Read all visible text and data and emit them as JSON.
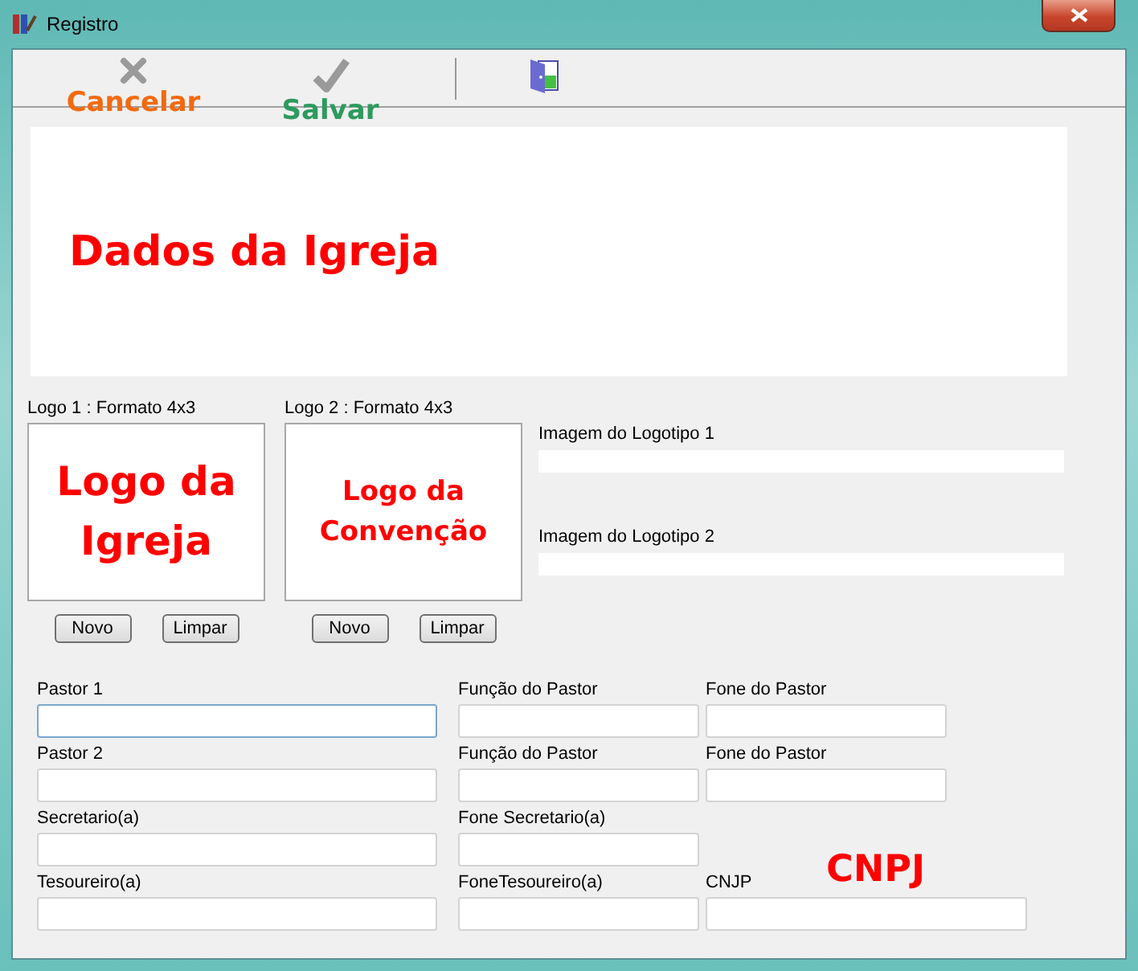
{
  "window": {
    "title": "Registro"
  },
  "toolbar": [
    {
      "kind": "cancel",
      "label": "Cancelar",
      "color": "#f26a10"
    },
    {
      "kind": "save",
      "label": "Salvar",
      "color": "#2e9a5e"
    },
    {
      "kind": "exit"
    }
  ],
  "header": {
    "title": "Dados da Igreja"
  },
  "logos": [
    {
      "label": "Logo 1 : Formato 4x3",
      "text": "Logo da Igreja",
      "buttons": [
        "Novo",
        "Limpar"
      ]
    },
    {
      "label": "Logo 2 : Formato 4x3",
      "text": "Logo da Convenção",
      "buttons": [
        "Novo",
        "Limpar"
      ]
    }
  ],
  "logo_paths": [
    {
      "label": "Imagem do Logotipo 1"
    },
    {
      "label": "Imagem do Logotipo 2"
    }
  ],
  "form_rows": [
    [
      {
        "label": "Pastor 1",
        "focused": true
      },
      {
        "label": "Função do Pastor",
        "focused": false
      },
      {
        "label": "Fone do Pastor",
        "focused": false
      }
    ],
    [
      {
        "label": "Pastor 2",
        "focused": false
      },
      {
        "label": "Função do Pastor",
        "focused": false
      },
      {
        "label": "Fone do Pastor",
        "focused": false
      }
    ],
    [
      {
        "label": "Secretario(a)",
        "focused": false
      },
      {
        "label": "Fone Secretario(a)",
        "focused": false
      }
    ],
    [
      {
        "label": "Tesoureiro(a)",
        "focused": false
      },
      {
        "label": "FoneTesoureiro(a)",
        "focused": false
      },
      {
        "label": "CNJP",
        "focused": false,
        "note": "CNPJ"
      }
    ]
  ]
}
